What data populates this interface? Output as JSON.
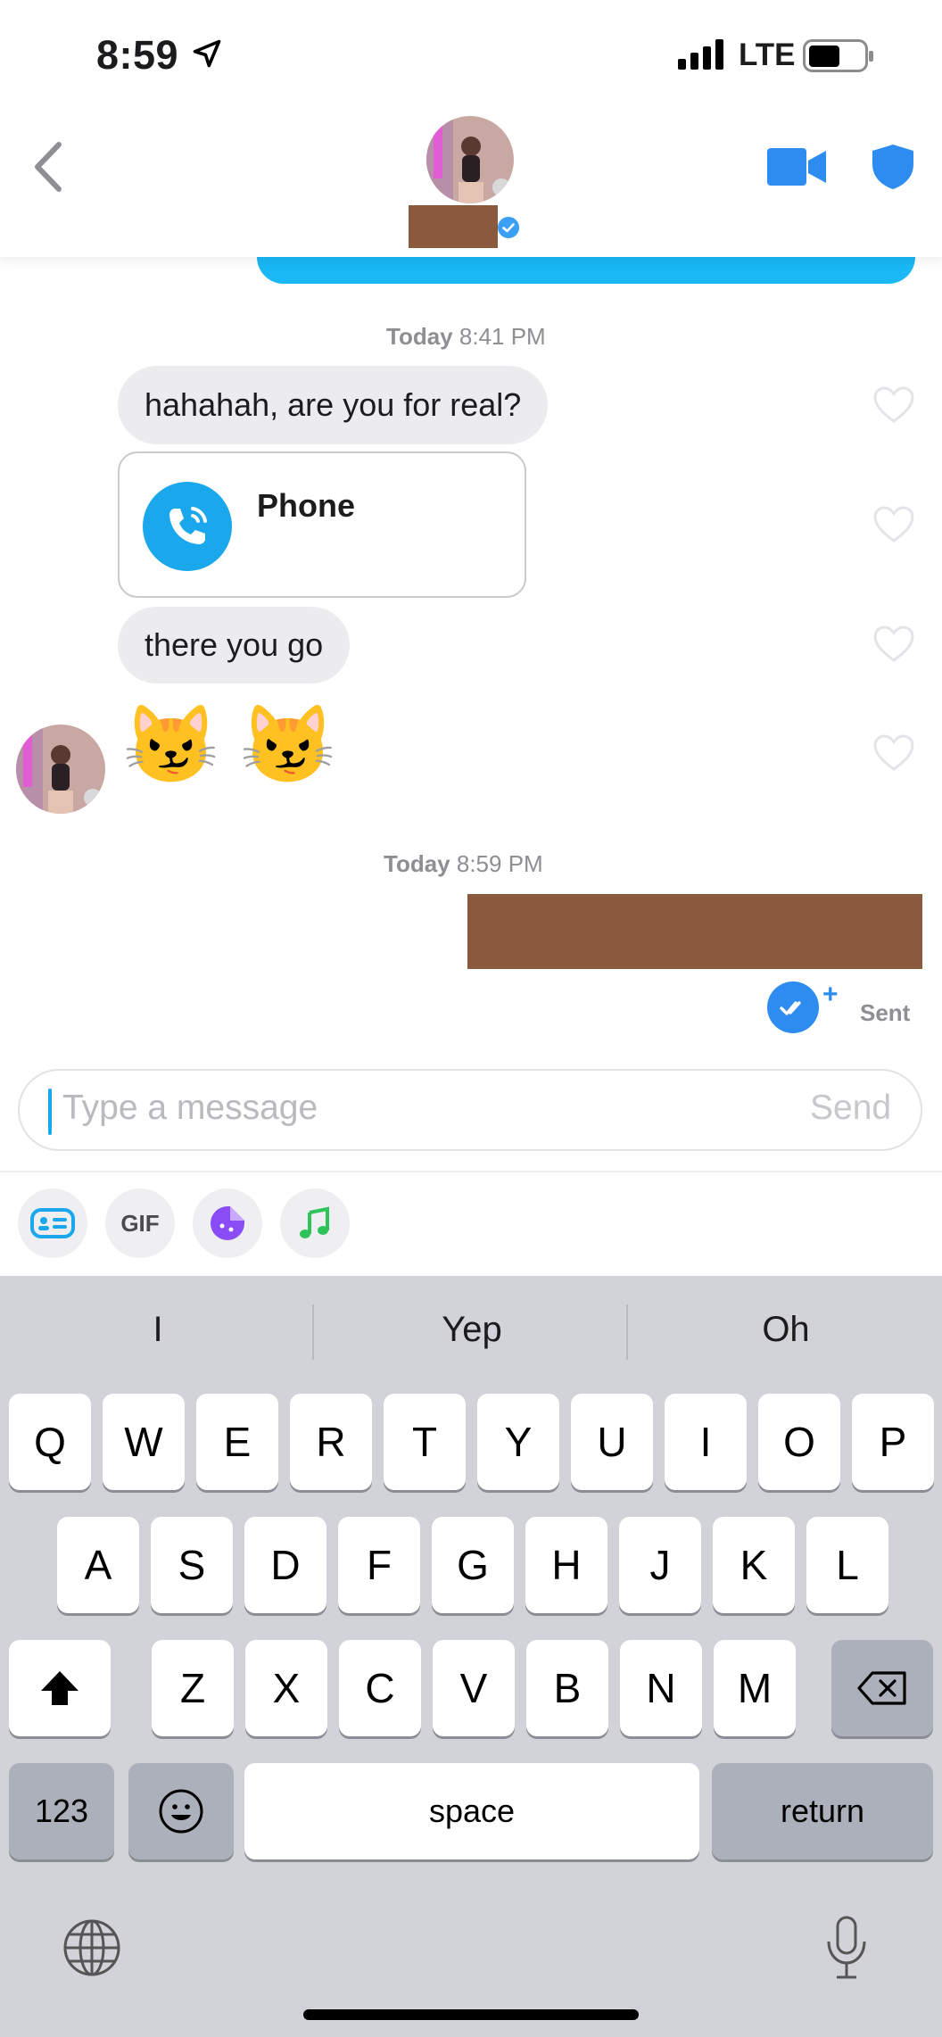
{
  "status_bar": {
    "time": "8:59",
    "network": "LTE"
  },
  "header": {
    "avatar": "profile-photo"
  },
  "timestamps": [
    {
      "day": "Today",
      "time": "8:41 PM"
    },
    {
      "day": "Today",
      "time": "8:59 PM"
    }
  ],
  "messages": {
    "m1": "hahahah, are you for real?",
    "phone_card_label": "Phone",
    "m2": "there you go",
    "emoji": "😼 😼"
  },
  "sent_status": "Sent",
  "composer": {
    "placeholder": "Type a message",
    "send_label": "Send"
  },
  "tools": {
    "gif_label": "GIF"
  },
  "keyboard": {
    "suggestions": [
      "I",
      "Yep",
      "Oh"
    ],
    "row1": [
      "Q",
      "W",
      "E",
      "R",
      "T",
      "Y",
      "U",
      "I",
      "O",
      "P"
    ],
    "row2": [
      "A",
      "S",
      "D",
      "F",
      "G",
      "H",
      "J",
      "K",
      "L"
    ],
    "row3": [
      "Z",
      "X",
      "C",
      "V",
      "B",
      "N",
      "M"
    ],
    "numbers_key": "123",
    "space_key": "space",
    "return_key": "return"
  },
  "colors": {
    "accent_blue": "#1aa7ec",
    "bubble_gray": "#ececef",
    "sent_bubble": "#1ab8f5",
    "redaction": "#8b5a3c"
  }
}
